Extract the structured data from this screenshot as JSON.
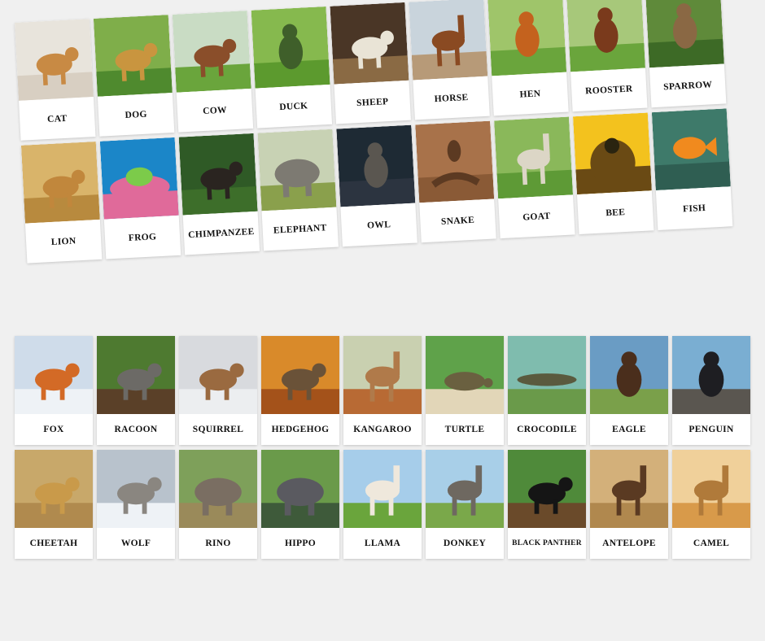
{
  "sheet_top": {
    "rows": [
      [
        {
          "label": "CAT",
          "icon": "cat",
          "sky": "#e8e4dc",
          "ground": "#d8cfc2",
          "body": "#c88a44"
        },
        {
          "label": "DOG",
          "icon": "dog",
          "sky": "#7fae4a",
          "ground": "#4f8a2e",
          "body": "#c9953f"
        },
        {
          "label": "COW",
          "icon": "cow",
          "sky": "#c9dcc4",
          "ground": "#6aa53c",
          "body": "#8a4e2a"
        },
        {
          "label": "DUCK",
          "icon": "duck",
          "sky": "#86b94e",
          "ground": "#5c9a2e",
          "body": "#3f5f2a"
        },
        {
          "label": "SHEEP",
          "icon": "sheep",
          "sky": "#4a3626",
          "ground": "#8a6a44",
          "body": "#e9e4d6"
        },
        {
          "label": "HORSE",
          "icon": "horse",
          "sky": "#c9d4dc",
          "ground": "#b79a78",
          "body": "#8a4a22"
        },
        {
          "label": "HEN",
          "icon": "hen",
          "sky": "#9fc56a",
          "ground": "#6aa53c",
          "body": "#c4621e"
        },
        {
          "label": "ROOSTER",
          "icon": "rooster",
          "sky": "#a7c87a",
          "ground": "#6aa53c",
          "body": "#7a3a1c"
        },
        {
          "label": "SPARROW",
          "icon": "sparrow",
          "sky": "#5f8a3a",
          "ground": "#3d6a26",
          "body": "#8a6844"
        }
      ],
      [
        {
          "label": "LION",
          "icon": "lion",
          "sky": "#d9b46a",
          "ground": "#b88a3e",
          "body": "#c1873c"
        },
        {
          "label": "FROG",
          "icon": "frog",
          "sky": "#1b86c8",
          "ground": "#e06a9a",
          "body": "#7ccb4a"
        },
        {
          "label": "CHIMPANZEE",
          "icon": "chimp",
          "sky": "#2f5a26",
          "ground": "#3d6e2a",
          "body": "#2a2420"
        },
        {
          "label": "ELEPHANT",
          "icon": "elephant",
          "sky": "#c8d2b4",
          "ground": "#8aa04c",
          "body": "#7d7a72"
        },
        {
          "label": "OWL",
          "icon": "owl",
          "sky": "#1e2a34",
          "ground": "#2c3440",
          "body": "#5a5650"
        },
        {
          "label": "SNAKE",
          "icon": "snake",
          "sky": "#a8724a",
          "ground": "#8a5a36",
          "body": "#5c3a22"
        },
        {
          "label": "GOAT",
          "icon": "goat",
          "sky": "#8ab85a",
          "ground": "#5e9a36",
          "body": "#dcd6c6"
        },
        {
          "label": "BEE",
          "icon": "bee",
          "sky": "#f3c21e",
          "ground": "#6a4a14",
          "body": "#2a2410"
        },
        {
          "label": "FISH",
          "icon": "fish",
          "sky": "#3e7a6a",
          "ground": "#2f5e52",
          "body": "#f08a1e"
        }
      ]
    ]
  },
  "sheet_bottom": {
    "rows": [
      [
        {
          "label": "FOX",
          "icon": "fox",
          "sky": "#cfdcea",
          "ground": "#eef2f6",
          "body": "#d36a26"
        },
        {
          "label": "RACOON",
          "icon": "racoon",
          "sky": "#4e7a30",
          "ground": "#5a4028",
          "body": "#6c6a66"
        },
        {
          "label": "SQUIRREL",
          "icon": "squirrel",
          "sky": "#d8dade",
          "ground": "#eceef0",
          "body": "#9a6a40"
        },
        {
          "label": "HEDGEHOG",
          "icon": "hedgehog",
          "sky": "#d98a2a",
          "ground": "#a4521a",
          "body": "#6a5238"
        },
        {
          "label": "KANGAROO",
          "icon": "kangaroo",
          "sky": "#c9d0b0",
          "ground": "#b86a34",
          "body": "#b07a4a"
        },
        {
          "label": "TURTLE",
          "icon": "turtle",
          "sky": "#5fa24a",
          "ground": "#e2d6b8",
          "body": "#6a6040"
        },
        {
          "label": "CROCODILE",
          "icon": "crocodile",
          "sky": "#7fbcae",
          "ground": "#6a9a4a",
          "body": "#5a5a3e"
        },
        {
          "label": "EAGLE",
          "icon": "eagle",
          "sky": "#6a9cc4",
          "ground": "#7aa04a",
          "body": "#4a2e1c"
        },
        {
          "label": "PENGUIN",
          "icon": "penguin",
          "sky": "#7aaed2",
          "ground": "#5a5650",
          "body": "#1e1e22"
        }
      ],
      [
        {
          "label": "CHEETAH",
          "icon": "cheetah",
          "sky": "#c8a86a",
          "ground": "#b08a4e",
          "body": "#c99a4a"
        },
        {
          "label": "WOLF",
          "icon": "wolf",
          "sky": "#b8c2cc",
          "ground": "#eef2f6",
          "body": "#8a8680"
        },
        {
          "label": "RINO",
          "icon": "rhino",
          "sky": "#7ea05a",
          "ground": "#9a8a5a",
          "body": "#7a6e62"
        },
        {
          "label": "HIPPO",
          "icon": "hippo",
          "sky": "#6a9a4a",
          "ground": "#3e5a3a",
          "body": "#5a5a60"
        },
        {
          "label": "LLAMA",
          "icon": "llama",
          "sky": "#a6cdea",
          "ground": "#6aa53c",
          "body": "#efe8dc"
        },
        {
          "label": "DONKEY",
          "icon": "donkey",
          "sky": "#a8cfe8",
          "ground": "#7aa84a",
          "body": "#6e6860"
        },
        {
          "label": "BLACK PANTHER",
          "icon": "panther",
          "sky": "#4f8a3a",
          "ground": "#6a4a2a",
          "body": "#151515"
        },
        {
          "label": "ANTELOPE",
          "icon": "antelope",
          "sky": "#d3b07a",
          "ground": "#b0884e",
          "body": "#5a3a22"
        },
        {
          "label": "CAMEL",
          "icon": "camel",
          "sky": "#f0d09a",
          "ground": "#d89a4a",
          "body": "#b07a3a"
        }
      ]
    ]
  }
}
